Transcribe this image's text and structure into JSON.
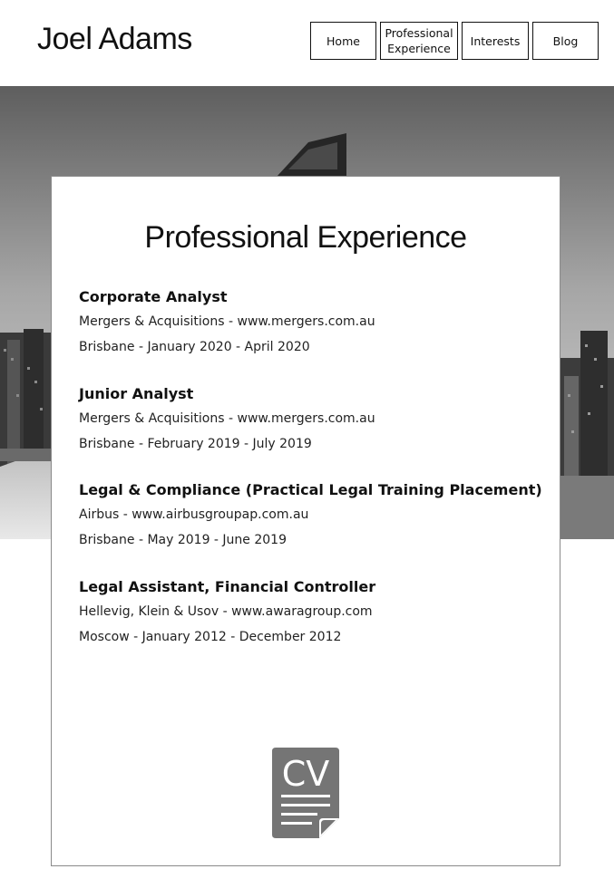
{
  "header": {
    "site_title": "Joel Adams",
    "nav": {
      "home": "Home",
      "professional_experience_line1": "Professional",
      "professional_experience_line2": "Experience",
      "interests": "Interests",
      "blog": "Blog"
    }
  },
  "main": {
    "title": "Professional Experience",
    "jobs": [
      {
        "title": "Corporate Analyst",
        "company": "Mergers & Acquisitions - www.mergers.com.au",
        "location_dates": "Brisbane - January 2020 - April 2020"
      },
      {
        "title": "Junior Analyst",
        "company": "Mergers & Acquisitions - www.mergers.com.au",
        "location_dates": "Brisbane - February 2019 - July 2019"
      },
      {
        "title": "Legal & Compliance (Practical Legal Training Placement)",
        "company": "Airbus - www.airbusgroupap.com.au",
        "location_dates": "Brisbane - May 2019 - June 2019"
      },
      {
        "title": "Legal Assistant, Financial Controller",
        "company": "Hellevig, Klein & Usov - www.awaragroup.com",
        "location_dates": "Moscow - January 2012 - December 2012"
      }
    ],
    "cv_icon_text": "CV"
  },
  "icons": {
    "cv": "cv-document-icon",
    "hero": "city-skyline-image"
  },
  "colors": {
    "background": "#ffffff",
    "text": "#111111",
    "cv_icon": "#757575"
  }
}
